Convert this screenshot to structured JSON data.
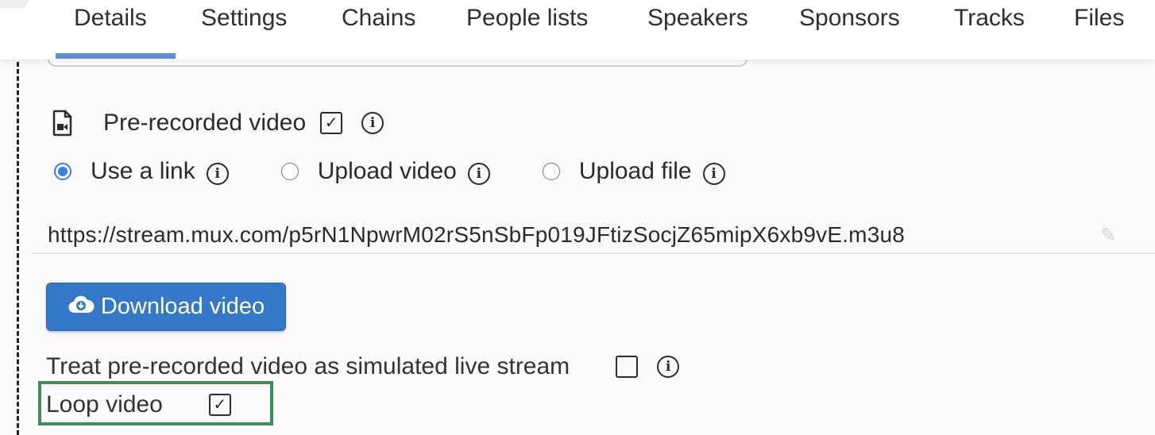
{
  "tabs": [
    {
      "label": "Details",
      "active": true
    },
    {
      "label": "Settings"
    },
    {
      "label": "Chains"
    },
    {
      "label": "People lists"
    },
    {
      "label": "Speakers"
    },
    {
      "label": "Sponsors"
    },
    {
      "label": "Tracks"
    },
    {
      "label": "Files"
    }
  ],
  "prerecorded": {
    "label": "Pre-recorded video",
    "checked": true,
    "icon": "file-video-icon"
  },
  "source_options": [
    {
      "label": "Use a link",
      "selected": true
    },
    {
      "label": "Upload video",
      "selected": false
    },
    {
      "label": "Upload file",
      "selected": false
    }
  ],
  "video_url": "https://stream.mux.com/p5rN1NpwrM02rS5nSbFp019JFtizSocjZ65mipX6xb9vE.m3u8",
  "download_button": {
    "label": "Download video",
    "icon": "cloud-download-icon"
  },
  "simulated_live": {
    "label": "Treat pre-recorded video as simulated live stream",
    "checked": false
  },
  "loop_video": {
    "label": "Loop video",
    "checked": true
  },
  "colors": {
    "accent": "#3478c8",
    "highlight": "#3e8e5a",
    "radio": "#3b7de8"
  }
}
